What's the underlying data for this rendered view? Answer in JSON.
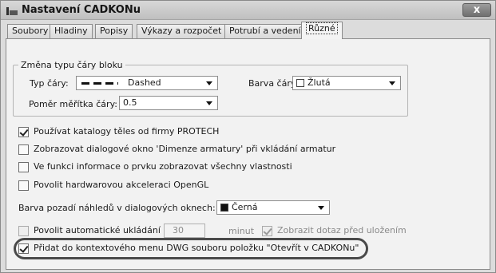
{
  "window": {
    "title": "Nastavení CADKONu",
    "close_label": "x"
  },
  "tabs": [
    {
      "label": "Soubory",
      "active": false
    },
    {
      "label": "Hladiny",
      "active": false
    },
    {
      "label": "Popisy",
      "active": false
    },
    {
      "label": "Výkazy a rozpočet",
      "active": false
    },
    {
      "label": "Potrubí a vedení",
      "active": false
    },
    {
      "label": "Různé",
      "active": true
    }
  ],
  "block_line_group": {
    "legend": "Změna typu čáry bloku",
    "line_type_label": "Typ čáry:",
    "line_type_value": "Dashed",
    "line_color_label": "Barva čáry:",
    "line_color_value": "Žlutá",
    "scale_label": "Poměr měřítka čáry:",
    "scale_value": "0.5"
  },
  "options": {
    "protech": {
      "label": "Používat katalogy těles od firmy PROTECH",
      "checked": true
    },
    "dimension_dialog": {
      "label": "Zobrazovat dialogové okno 'Dimenze armatury' při vkládání armatur",
      "checked": false
    },
    "show_all_props": {
      "label": "Ve funkci informace o prvku zobrazovat všechny vlastnosti",
      "checked": false
    },
    "opengl": {
      "label": "Povolit hardwarovou akceleraci OpenGL",
      "checked": false
    }
  },
  "preview_bg": {
    "label": "Barva pozadí náhledů v dialogových oknech:",
    "value": "Černá"
  },
  "autosave": {
    "label": "Povolit automatické ukládání",
    "checked": false,
    "minutes_value": "30",
    "minutes_unit": "minut",
    "confirm_label": "Zobrazit dotaz před uložením",
    "confirm_checked": true
  },
  "context_menu": {
    "label": "Přidat do kontextového menu DWG souboru položku \"Otevřít v CADKONu\"",
    "checked": true
  },
  "colors": {
    "swatch_black": "#111111",
    "swatch_white": "#ffffff"
  }
}
